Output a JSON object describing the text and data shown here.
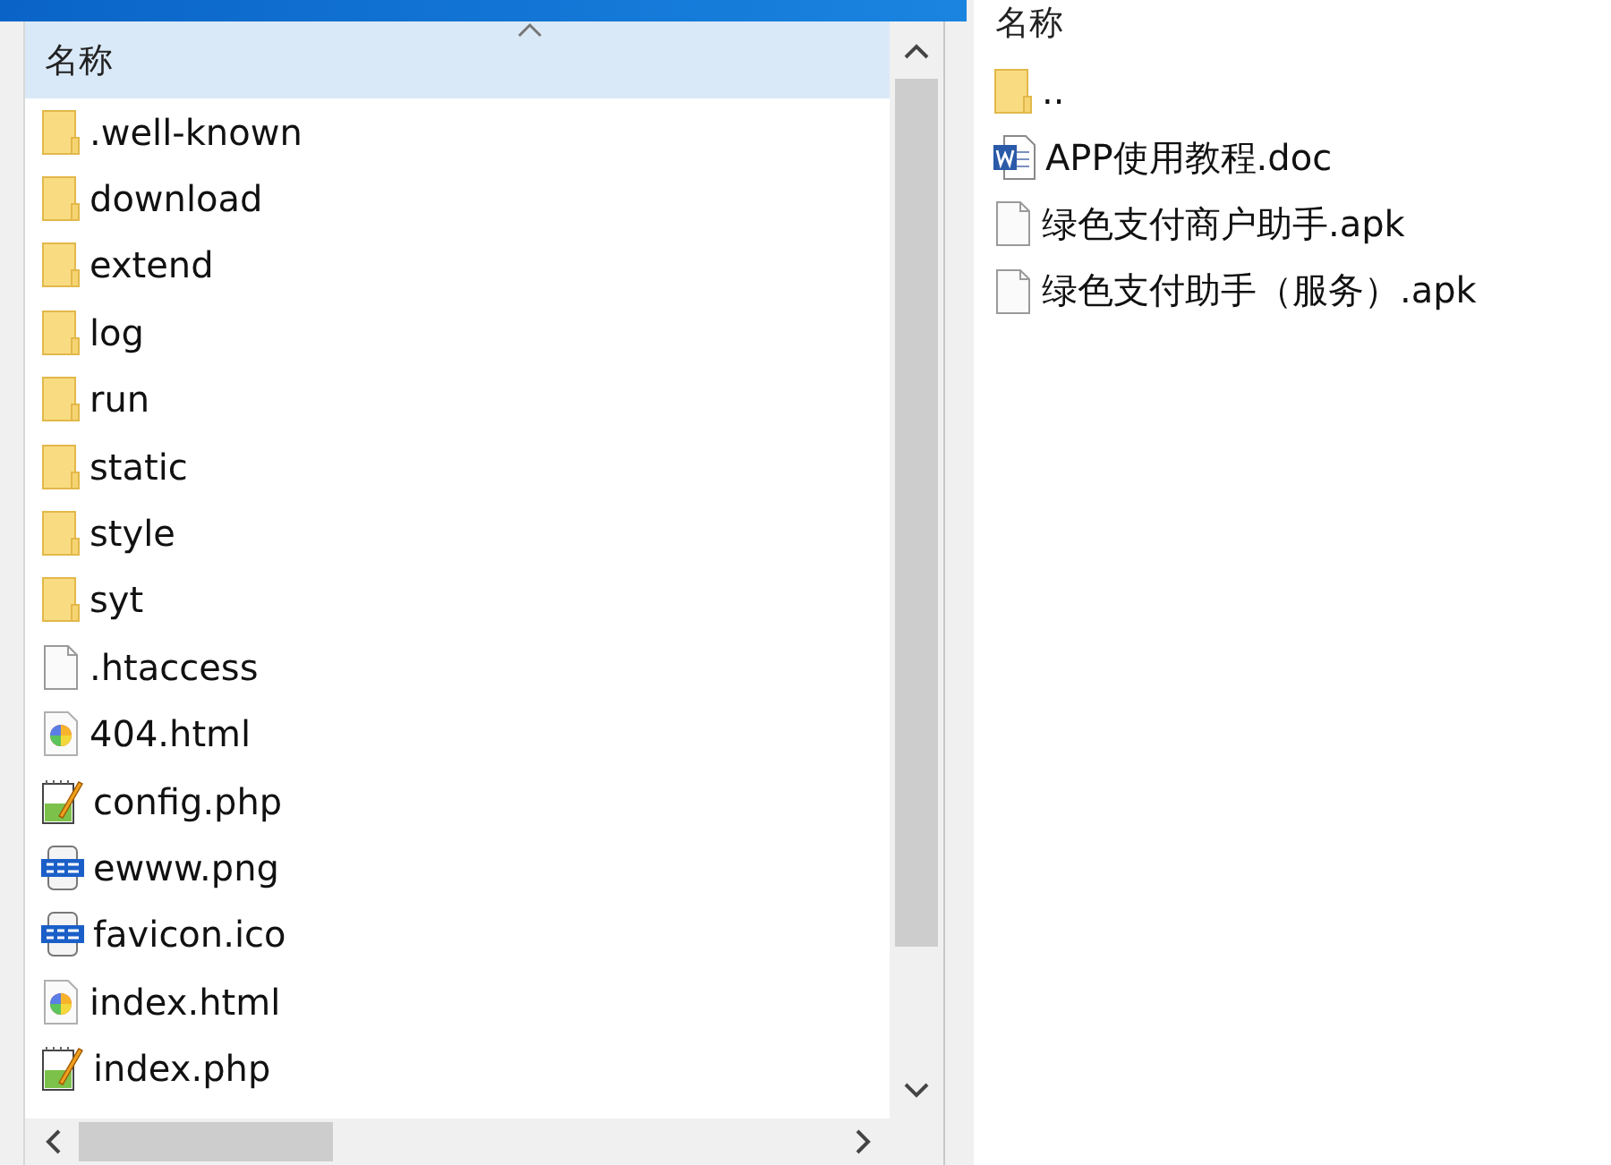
{
  "left_pane": {
    "header": "名称",
    "items": [
      {
        "name": ".well-known",
        "kind": "folder"
      },
      {
        "name": "download",
        "kind": "folder"
      },
      {
        "name": "extend",
        "kind": "folder"
      },
      {
        "name": "log",
        "kind": "folder"
      },
      {
        "name": "run",
        "kind": "folder"
      },
      {
        "name": "static",
        "kind": "folder"
      },
      {
        "name": "style",
        "kind": "folder"
      },
      {
        "name": "syt",
        "kind": "folder"
      },
      {
        "name": ".htaccess",
        "kind": "file"
      },
      {
        "name": "404.html",
        "kind": "html"
      },
      {
        "name": "config.php",
        "kind": "php"
      },
      {
        "name": "ewww.png",
        "kind": "png"
      },
      {
        "name": "favicon.ico",
        "kind": "ico"
      },
      {
        "name": "index.html",
        "kind": "html"
      },
      {
        "name": "index.php",
        "kind": "php"
      }
    ]
  },
  "right_pane": {
    "header": "名称",
    "items": [
      {
        "name": "..",
        "kind": "folder"
      },
      {
        "name": "APP使用教程.doc",
        "kind": "doc"
      },
      {
        "name": "绿色支付商户助手.apk",
        "kind": "file"
      },
      {
        "name": "绿色支付助手（服务）.apk",
        "kind": "file"
      }
    ]
  }
}
